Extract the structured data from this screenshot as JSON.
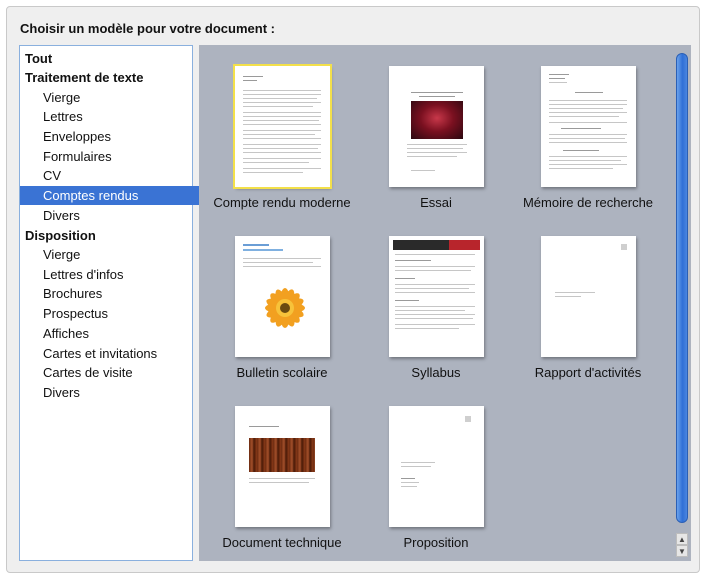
{
  "dialog": {
    "prompt": "Choisir un modèle pour votre document :"
  },
  "sidebar": {
    "items": [
      {
        "label": "Tout",
        "level": "category"
      },
      {
        "label": "Traitement de texte",
        "level": "category"
      },
      {
        "label": "Vierge",
        "level": "subcategory"
      },
      {
        "label": "Lettres",
        "level": "subcategory"
      },
      {
        "label": "Enveloppes",
        "level": "subcategory"
      },
      {
        "label": "Formulaires",
        "level": "subcategory"
      },
      {
        "label": "CV",
        "level": "subcategory"
      },
      {
        "label": "Comptes rendus",
        "level": "subcategory",
        "selected": true
      },
      {
        "label": "Divers",
        "level": "subcategory"
      },
      {
        "label": "Disposition",
        "level": "category"
      },
      {
        "label": "Vierge",
        "level": "subcategory"
      },
      {
        "label": "Lettres d'infos",
        "level": "subcategory"
      },
      {
        "label": "Brochures",
        "level": "subcategory"
      },
      {
        "label": "Prospectus",
        "level": "subcategory"
      },
      {
        "label": "Affiches",
        "level": "subcategory"
      },
      {
        "label": "Cartes et invitations",
        "level": "subcategory"
      },
      {
        "label": "Cartes de visite",
        "level": "subcategory"
      },
      {
        "label": "Divers",
        "level": "subcategory"
      }
    ],
    "selected_color": "#3a73d4"
  },
  "gallery": {
    "background": "#adb3bf",
    "selected_outline_color": "#f3e04a",
    "templates": [
      {
        "label": "Compte rendu moderne",
        "selected": true
      },
      {
        "label": "Essai"
      },
      {
        "label": "Mémoire de recherche"
      },
      {
        "label": "Bulletin scolaire"
      },
      {
        "label": "Syllabus"
      },
      {
        "label": "Rapport d'activités"
      },
      {
        "label": "Document technique"
      },
      {
        "label": "Proposition"
      }
    ]
  },
  "scrollbar": {
    "up_icon": "triangle-up",
    "down_icon": "triangle-down"
  }
}
